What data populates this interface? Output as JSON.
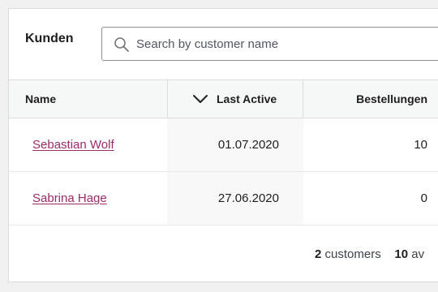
{
  "header": {
    "title": "Kunden",
    "search_placeholder": "Search by customer name",
    "search_value": ""
  },
  "table": {
    "columns": {
      "name": "Name",
      "last_active": "Last Active",
      "orders": "Bestellungen"
    },
    "rows": [
      {
        "name": "Sebastian Wolf",
        "last_active": "01.07.2020",
        "orders": "10"
      },
      {
        "name": "Sabrina Hage",
        "last_active": "27.06.2020",
        "orders": "0"
      }
    ]
  },
  "footer": {
    "customers_count": "2",
    "customers_label": "customers",
    "second_count": "10",
    "second_label": "av"
  },
  "colors": {
    "link": "#9d2b6b",
    "header_bg": "#f6f7f7",
    "border": "#dcdcde"
  }
}
